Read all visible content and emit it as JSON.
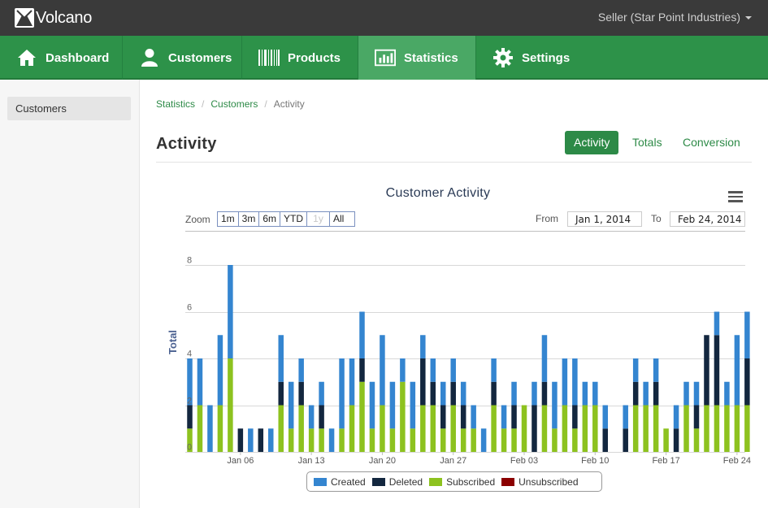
{
  "app": {
    "name": "Volcano",
    "user_menu": "Seller (Star Point Industries)"
  },
  "nav": {
    "items": [
      {
        "label": "Dashboard",
        "icon": "home-icon"
      },
      {
        "label": "Customers",
        "icon": "user-icon"
      },
      {
        "label": "Products",
        "icon": "barcode-icon"
      },
      {
        "label": "Statistics",
        "icon": "bar-chart-icon",
        "active": true
      },
      {
        "label": "Settings",
        "icon": "gear-icon"
      }
    ]
  },
  "sidebar": {
    "items": [
      {
        "label": "Customers",
        "active": true
      }
    ]
  },
  "breadcrumb": [
    "Statistics",
    "Customers",
    "Activity"
  ],
  "page": {
    "title": "Activity"
  },
  "tabs": [
    {
      "label": "Activity",
      "active": true
    },
    {
      "label": "Totals"
    },
    {
      "label": "Conversion"
    }
  ],
  "range": {
    "zoom_label": "Zoom",
    "zoom_buttons": [
      {
        "label": "1m"
      },
      {
        "label": "3m"
      },
      {
        "label": "6m"
      },
      {
        "label": "YTD"
      },
      {
        "label": "1y",
        "disabled": true
      },
      {
        "label": "All"
      }
    ],
    "from_label": "From",
    "from_value": "Jan 1, 2014",
    "to_label": "To",
    "to_value": "Feb 24, 2014"
  },
  "colors": {
    "accent": "#2d8a47",
    "created": "#3485d0",
    "deleted": "#13273f",
    "subscribed": "#8dc21f",
    "unsubscribed": "#8b0000"
  },
  "chart_data": {
    "type": "bar",
    "title": "Customer Activity",
    "ylabel": "Total",
    "ylim": [
      0,
      8
    ],
    "yticks": [
      0,
      2,
      4,
      6,
      8
    ],
    "stacked": true,
    "grid": true,
    "legend_position": "bottom",
    "x_ticks": [
      "Jan 06",
      "Jan 13",
      "Jan 20",
      "Jan 27",
      "Feb 03",
      "Feb 10",
      "Feb 17",
      "Feb 24"
    ],
    "categories": [
      "Jan 01",
      "Jan 02",
      "Jan 03",
      "Jan 04",
      "Jan 05",
      "Jan 06",
      "Jan 07",
      "Jan 08",
      "Jan 09",
      "Jan 10",
      "Jan 11",
      "Jan 12",
      "Jan 13",
      "Jan 14",
      "Jan 15",
      "Jan 16",
      "Jan 17",
      "Jan 18",
      "Jan 19",
      "Jan 20",
      "Jan 21",
      "Jan 22",
      "Jan 23",
      "Jan 24",
      "Jan 25",
      "Jan 26",
      "Jan 27",
      "Jan 28",
      "Jan 29",
      "Jan 30",
      "Jan 31",
      "Feb 01",
      "Feb 02",
      "Feb 03",
      "Feb 04",
      "Feb 05",
      "Feb 06",
      "Feb 07",
      "Feb 08",
      "Feb 09",
      "Feb 10",
      "Feb 11",
      "Feb 12",
      "Feb 13",
      "Feb 14",
      "Feb 15",
      "Feb 16",
      "Feb 17",
      "Feb 18",
      "Feb 19",
      "Feb 20",
      "Feb 21",
      "Feb 22",
      "Feb 23",
      "Feb 24",
      "Feb 25"
    ],
    "series": [
      {
        "name": "Created",
        "color": "#3485d0",
        "values": [
          2,
          2,
          2,
          3,
          4,
          0,
          1,
          0,
          1,
          2,
          2,
          1,
          1,
          1,
          1,
          3,
          2,
          2,
          2,
          3,
          2,
          1,
          2,
          1,
          1,
          1,
          1,
          1,
          1,
          1,
          1,
          1,
          1,
          0,
          1,
          2,
          2,
          2,
          2,
          1,
          1,
          1,
          0,
          1,
          1,
          1,
          1,
          0,
          1,
          1,
          1,
          0,
          1,
          1,
          3,
          2
        ]
      },
      {
        "name": "Deleted",
        "color": "#13273f",
        "values": [
          1,
          0,
          0,
          0,
          0,
          1,
          0,
          1,
          0,
          1,
          0,
          1,
          0,
          1,
          0,
          0,
          0,
          1,
          0,
          0,
          0,
          0,
          0,
          2,
          1,
          1,
          1,
          1,
          0,
          0,
          1,
          0,
          1,
          0,
          2,
          1,
          0,
          0,
          1,
          0,
          0,
          1,
          0,
          1,
          1,
          0,
          1,
          0,
          1,
          0,
          1,
          3,
          3,
          0,
          0,
          2
        ]
      },
      {
        "name": "Subscribed",
        "color": "#8dc21f",
        "values": [
          1,
          2,
          0,
          2,
          4,
          0,
          0,
          0,
          0,
          2,
          1,
          2,
          1,
          1,
          0,
          1,
          2,
          3,
          1,
          2,
          1,
          3,
          1,
          2,
          2,
          1,
          2,
          1,
          1,
          0,
          2,
          1,
          1,
          2,
          0,
          2,
          1,
          2,
          1,
          2,
          2,
          0,
          0,
          0,
          2,
          2,
          2,
          1,
          0,
          2,
          1,
          2,
          2,
          2,
          2,
          2
        ]
      },
      {
        "name": "Unsubscribed",
        "color": "#8b0000",
        "values": [
          0,
          0,
          0,
          0,
          0,
          0,
          0,
          0,
          0,
          0,
          0,
          0,
          0,
          0,
          0,
          0,
          0,
          0,
          0,
          0,
          0,
          0,
          0,
          0,
          0,
          0,
          0,
          0,
          0,
          0,
          0,
          0,
          0,
          0,
          0,
          0,
          0,
          0,
          0,
          0,
          0,
          0,
          0,
          0,
          0,
          0,
          0,
          0,
          0,
          0,
          0,
          0,
          0,
          0,
          0,
          0
        ]
      }
    ]
  }
}
